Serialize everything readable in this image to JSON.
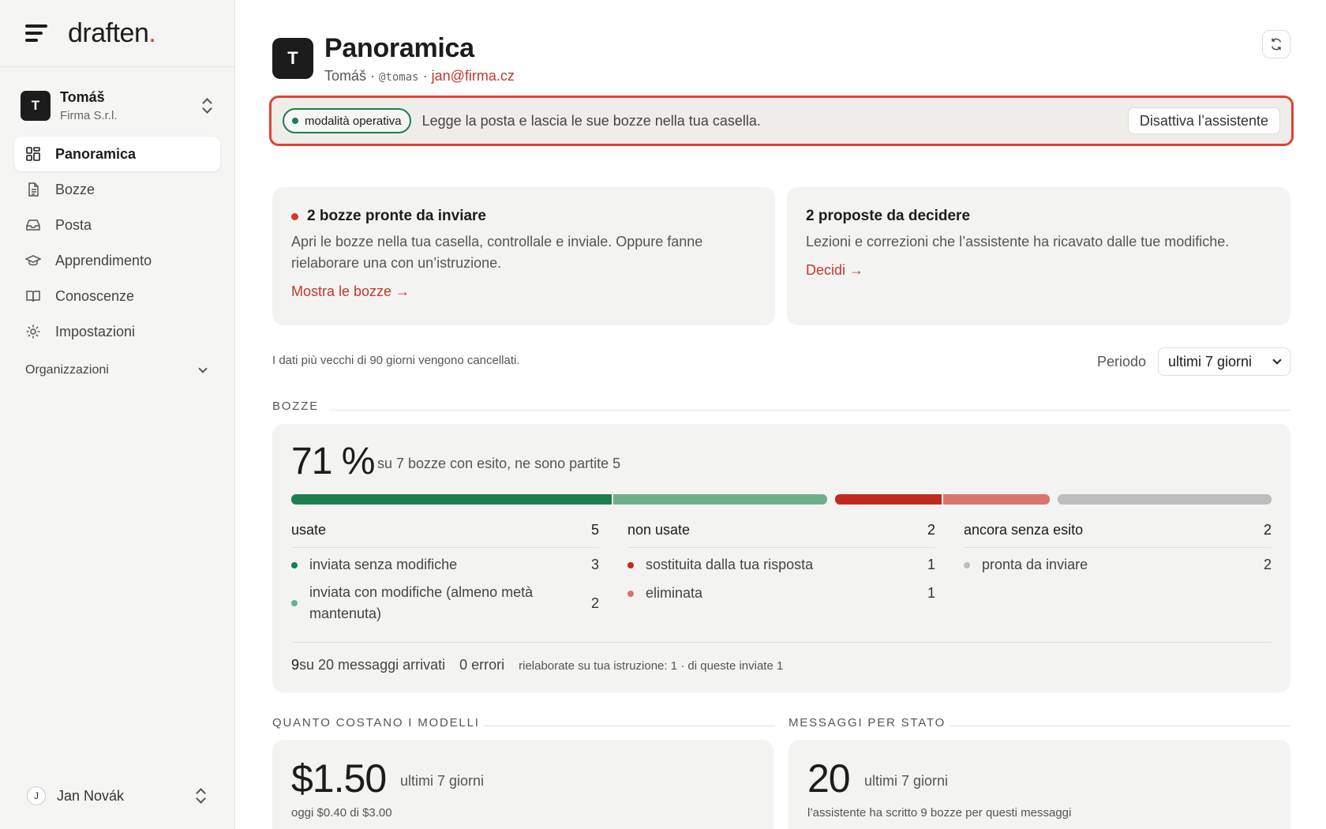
{
  "brand": {
    "name": "draften",
    "dot": "."
  },
  "account": {
    "initial": "T",
    "name": "Tomáš",
    "org": "Firma S.r.l."
  },
  "nav": [
    {
      "label": "Panoramica",
      "icon": "dashboard-icon",
      "active": true
    },
    {
      "label": "Bozze",
      "icon": "document-icon"
    },
    {
      "label": "Posta",
      "icon": "inbox-icon"
    },
    {
      "label": "Apprendimento",
      "icon": "graduation-cap-icon"
    },
    {
      "label": "Conoscenze",
      "icon": "book-icon"
    },
    {
      "label": "Impostazioni",
      "icon": "gear-icon"
    }
  ],
  "organizations_label": "Organizzazioni",
  "user": {
    "initial": "J",
    "name": "Jan Novák"
  },
  "header": {
    "initial": "T",
    "title": "Panoramica",
    "name": "Tomáš",
    "sep1": " · ",
    "handle": "@tomas",
    "sep2": " · ",
    "email": "jan@firma.cz"
  },
  "mode": {
    "badge": "modalità operativa",
    "text": "Legge la posta e lascia le sue bozze nella tua casella.",
    "button": "Disattiva l’assistente"
  },
  "cards": {
    "drafts": {
      "title": "2 bozze pronte da inviare",
      "desc": "Apri le bozze nella tua casella, controllale e inviale. Oppure fanne rielaborare una con un’istruzione.",
      "link": "Mostra le bozze →"
    },
    "proposals": {
      "title": "2 proposte da decidere",
      "desc": "Lezioni e correzioni che l’assistente ha ricavato dalle tue modifiche.",
      "link": "Decidi →"
    }
  },
  "retention_note": "I dati più vecchi di 90 giorni vengono cancellati.",
  "period": {
    "label": "Periodo",
    "value": "ultimi 7 giorni"
  },
  "bozze": {
    "section": "BOZZE",
    "percent": "71 %",
    "summary": "su 7 bozze con esito, ne sono partite 5",
    "segments": [
      {
        "name": "inviata senza modifiche",
        "value": 3,
        "color": "#1e7d4e"
      },
      {
        "name": "inviata con modifiche",
        "value": 2,
        "color": "#6fae8b"
      },
      {
        "name": "sostituita dalla tua risposta",
        "value": 1,
        "color": "#bf2a21"
      },
      {
        "name": "eliminata",
        "value": 1,
        "color": "#d6756c"
      },
      {
        "name": "pronta da inviare",
        "value": 2,
        "color": "#bdbdbd"
      }
    ],
    "columns": [
      {
        "title": "usate",
        "total": "5",
        "rows": [
          {
            "label": "inviata senza modifiche",
            "count": "3",
            "color": "#1e7d4e"
          },
          {
            "label": "inviata con modifiche (almeno metà mantenuta)",
            "count": "2",
            "color": "#6fae8b"
          }
        ]
      },
      {
        "title": "non usate",
        "total": "2",
        "rows": [
          {
            "label": "sostituita dalla tua risposta",
            "count": "1",
            "color": "#bf2a21"
          },
          {
            "label": "eliminata",
            "count": "1",
            "color": "#d6756c"
          }
        ]
      },
      {
        "title": "ancora senza esito",
        "total": "2",
        "rows": [
          {
            "label": "pronta da inviare",
            "count": "2",
            "color": "#bdbdbd"
          }
        ]
      }
    ],
    "footer": {
      "arrived_num": "9",
      "arrived_text": " su 20 messaggi arrivati",
      "errors": "0 errori",
      "reworked": "rielaborate su tua istruzione: 1 · di queste inviate 1"
    }
  },
  "costs": {
    "section": "QUANTO COSTANO I MODELLI",
    "amount": "$1.50",
    "period": "ultimi 7 giorni",
    "today": "oggi $0.40 di $3.00"
  },
  "messages": {
    "section": "MESSAGGI PER STATO",
    "count": "20",
    "period": "ultimi 7 giorni",
    "note": "l’assistente ha scritto 9 bozze per questi messaggi"
  }
}
